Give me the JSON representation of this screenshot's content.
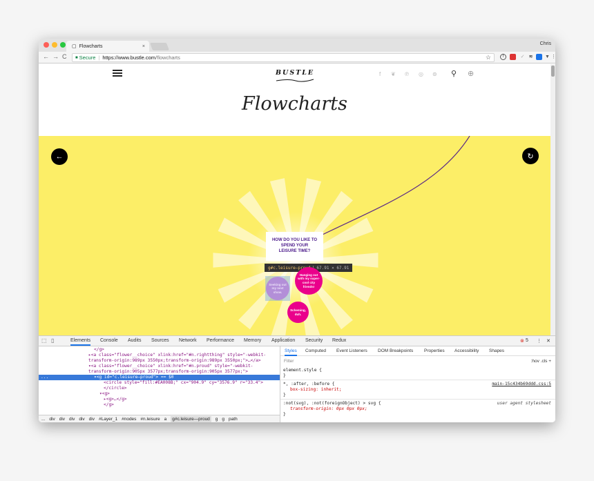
{
  "browser": {
    "tab_title": "Flowcharts",
    "tab_close": "×",
    "user": "Chris",
    "nav": {
      "back": "←",
      "forward": "→",
      "reload": "C"
    },
    "address": {
      "secure_label": "Secure",
      "separator": "|",
      "url_host": "https://www.bustle.com",
      "url_path": "/flowcharts"
    },
    "star": "☆"
  },
  "site": {
    "logo": "BUSTLE",
    "title": "Flowcharts",
    "social_icons": [
      "f",
      "twitter-icon",
      "p",
      "instagram-icon",
      "pinterest-icon"
    ],
    "colors": {
      "hero_bg": "#fcee67",
      "pink": "#ea008b",
      "purple_text": "#4b1a8a"
    },
    "question": "HOW DO YOU LIKE TO SPEND YOUR LEISURE TIME?",
    "tooltip": {
      "selector": "g#c.leisure—proud",
      "size": "67.91 × 67.91"
    },
    "bubbles": [
      {
        "text": "Hanging out with my super-cool city friends!"
      },
      {
        "text": "Seeking out my next show."
      },
      {
        "text": "Scheming, duh."
      }
    ]
  },
  "devtools": {
    "tabs": [
      "Elements",
      "Console",
      "Audits",
      "Sources",
      "Network",
      "Performance",
      "Memory",
      "Application",
      "Security",
      "Redux"
    ],
    "error_count": "5",
    "dom_lines": [
      {
        "indent": 80,
        "text": "</g>"
      },
      {
        "indent": 72,
        "text": "▸<a class=\"flower__choice\" xlink:href=\"#n.rightthing\" style=\"-webkit-"
      },
      {
        "indent": 72,
        "text": "transform-origin:989px 3550px;transform-origin:989px 3550px;\">…</a>"
      },
      {
        "indent": 72,
        "text": "▾<a class=\"flower__choice\" xlink:href=\"#n.proud\" style=\"-webkit-"
      },
      {
        "indent": 72,
        "text": "transform-origin:905px 3577px;transform-origin:905px 3577px;\">"
      },
      {
        "indent": 80,
        "text": "▾<g id=\"c.leisure—proud\"> == $0",
        "selected": true
      },
      {
        "indent": 94,
        "text": "<circle style=\"fill:#EA008B;\" cx=\"904.9\" cy=\"3576.9\" r=\"33.4\">"
      },
      {
        "indent": 94,
        "text": "</circle>"
      },
      {
        "indent": 88,
        "text": "▾<g>"
      },
      {
        "indent": 94,
        "text": "▸<g>…</g>"
      },
      {
        "indent": 94,
        "text": "</g>"
      }
    ],
    "breadcrumbs": [
      "...",
      "div",
      "div",
      "div",
      "div",
      "div",
      "#Layer_1",
      "#nodes",
      "#n.leisure",
      "a",
      "g#c.leisure—proud",
      "g",
      "g",
      "path"
    ],
    "styles_tabs": [
      "Styles",
      "Computed",
      "Event Listeners",
      "DOM Breakpoints",
      "Properties",
      "Accessibility",
      "Shapes"
    ],
    "filter_placeholder": "Filter",
    "filter_right": ":hov  .cls  +",
    "rules": [
      {
        "selector": "element.style {",
        "decls": [],
        "close": "}"
      },
      {
        "selector": "*, :after, :before {",
        "source": "main-15c434b69ddd.css:5",
        "decls": [
          "box-sizing: inherit;"
        ],
        "close": "}"
      },
      {
        "selector": ":not(svg), :not(foreignObject) > svg {",
        "source": "user agent stylesheet",
        "decls": [
          "transform-origin: 0px 0px 0px;"
        ],
        "close": "}"
      }
    ]
  }
}
